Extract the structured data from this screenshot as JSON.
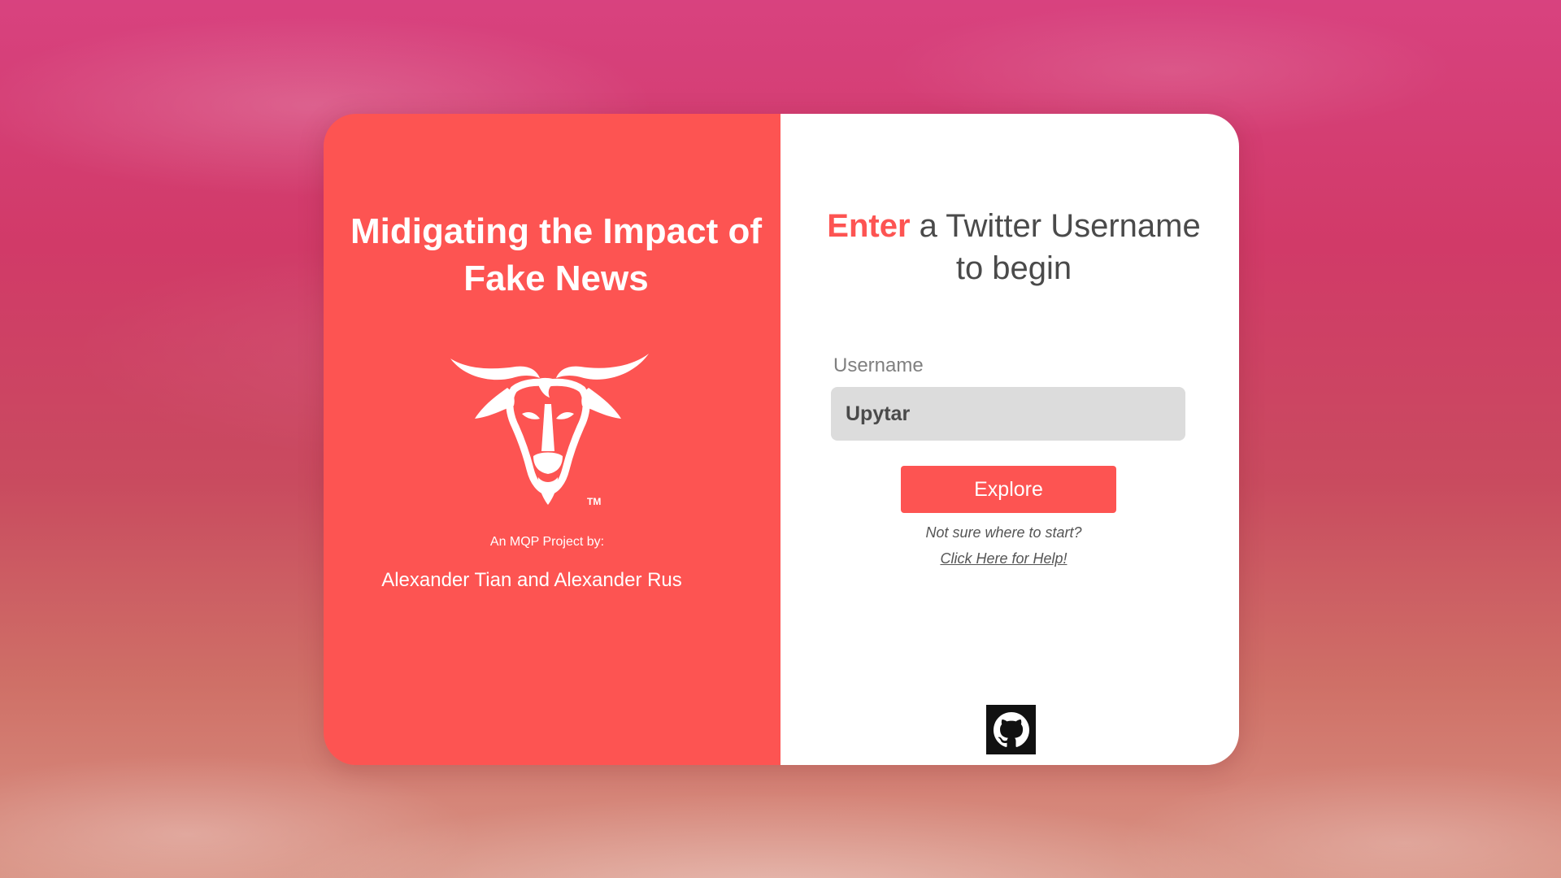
{
  "left_panel": {
    "title": "Midigating the Impact of Fake News",
    "logo_icon": "goat-head-logo",
    "logo_mark": "TM",
    "byline": "An MQP Project by:",
    "authors": "Alexander Tian and Alexander Rus"
  },
  "right_panel": {
    "heading_accent": "Enter",
    "heading_rest": " a Twitter Username",
    "heading_line2": "to begin",
    "username_label": "Username",
    "username_value": "Upytar",
    "explore_label": "Explore",
    "hint_text": "Not sure where to start?",
    "help_link": "Click Here for Help!",
    "github_icon": "github-icon"
  },
  "colors": {
    "accent": "#fd5452",
    "panel_right": "#ffffff",
    "input_bg": "#dcdcdc",
    "text_dark": "#4a4a4a",
    "github_bg": "#111111"
  }
}
